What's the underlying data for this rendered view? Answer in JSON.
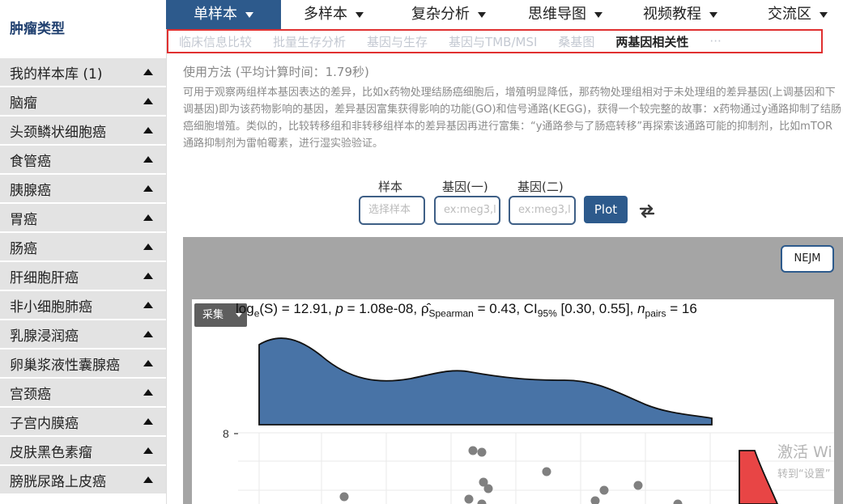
{
  "sidebar": {
    "title": "肿瘤类型",
    "items": [
      {
        "label": "我的样本库 (1)"
      },
      {
        "label": "脑瘤"
      },
      {
        "label": "头颈鳞状细胞癌"
      },
      {
        "label": "食管癌"
      },
      {
        "label": "胰腺癌"
      },
      {
        "label": "胃癌"
      },
      {
        "label": "肠癌"
      },
      {
        "label": "肝细胞肝癌"
      },
      {
        "label": "非小细胞肺癌"
      },
      {
        "label": "乳腺浸润癌"
      },
      {
        "label": "卵巢浆液性囊腺癌"
      },
      {
        "label": "宫颈癌"
      },
      {
        "label": "子宫内膜癌"
      },
      {
        "label": "皮肤黑色素瘤"
      },
      {
        "label": "膀胱尿路上皮癌"
      }
    ]
  },
  "nav": {
    "items": [
      {
        "label": "单样本",
        "active": true
      },
      {
        "label": "多样本"
      },
      {
        "label": "复杂分析"
      },
      {
        "label": "思维导图"
      },
      {
        "label": "视频教程"
      },
      {
        "label": "交流区"
      }
    ]
  },
  "subnav": {
    "items": [
      {
        "label": "临床信息比较"
      },
      {
        "label": "批量生存分析"
      },
      {
        "label": "基因与生存"
      },
      {
        "label": "基因与TMB/MSI"
      },
      {
        "label": "桑基图"
      },
      {
        "label": "两基因相关性",
        "active": true
      },
      {
        "label": "···"
      }
    ]
  },
  "description": {
    "title": "使用方法 (平均计算时间：1.79秒)",
    "body": "可用于观察两组样本基因表达的差异，比如x药物处理结肠癌细胞后，增殖明显降低，那药物处理组相对于未处理组的差异基因(上调基因和下调基因)即为该药物影响的基因，差异基因富集获得影响的功能(GO)和信号通路(KEGG)，获得一个较完整的故事：x药物通过y通路抑制了结肠癌细胞增殖。类似的，比较转移组和非转移组样本的差异基因再进行富集：“y通路参与了肠癌转移”再探索该通路可能的抑制剂，比如mTOR通路抑制剂为雷帕霉素，进行湿实验验证。"
  },
  "form": {
    "sample_label": "样本",
    "sample_placeholder": "选择样本",
    "gene1_label": "基因(一)",
    "gene1_placeholder": "ex:meg3,l",
    "gene2_label": "基因(二)",
    "gene2_placeholder": "ex:meg3,l",
    "plot_button": "Plot"
  },
  "plot": {
    "style_button": "NEJM",
    "collect_button": "采集",
    "stat": {
      "log_text": "log",
      "log_sub": "e",
      "s_text": "(S) = 12.91, ",
      "p_text": "p",
      "p_value": " = 1.08e-08, ",
      "rho_text": "ρ̂",
      "rho_sub": "Spearman",
      "rho_value": " = 0.43, CI",
      "ci_sub": "95%",
      "ci_value": " [0.30, 0.55], ",
      "n_text": "n",
      "n_sub": "pairs",
      "n_value": " = 16"
    },
    "y_tick": "8"
  },
  "watermark": {
    "line1": "激活 Wi",
    "line2": "转到“设置”"
  },
  "colors": {
    "accent": "#2d5a8c",
    "density_fill": "#4873a6",
    "highlight_red": "#e03030",
    "point": "#808080"
  },
  "chart_data": {
    "type": "scatter",
    "y_ticks": [
      "8"
    ],
    "points_visible": 12
  }
}
